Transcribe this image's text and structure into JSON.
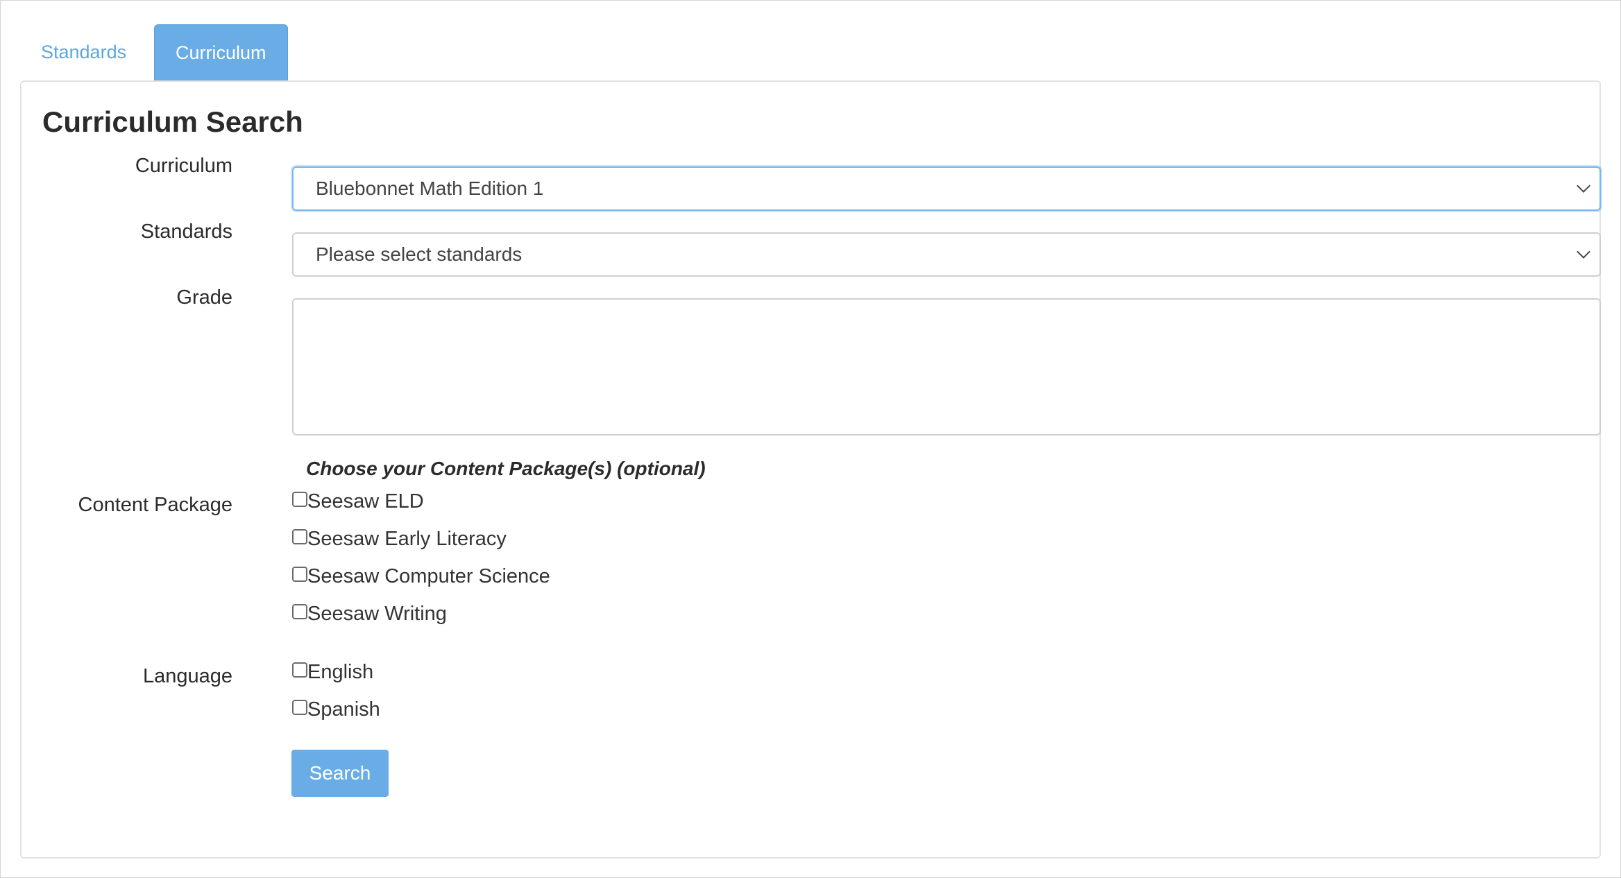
{
  "tabs": [
    {
      "label": "Standards",
      "active": false
    },
    {
      "label": "Curriculum",
      "active": true
    }
  ],
  "panel": {
    "title": "Curriculum Search"
  },
  "form": {
    "curriculum": {
      "label": "Curriculum",
      "value": "Bluebonnet Math Edition 1"
    },
    "standards": {
      "label": "Standards",
      "value": "Please select standards"
    },
    "grade": {
      "label": "Grade"
    },
    "content_package": {
      "label": "Content Package",
      "heading": "Choose your Content Package(s) (optional)",
      "options": [
        {
          "label": "Seesaw ELD",
          "checked": false
        },
        {
          "label": "Seesaw Early Literacy",
          "checked": false
        },
        {
          "label": "Seesaw Computer Science",
          "checked": false
        },
        {
          "label": "Seesaw Writing",
          "checked": false
        }
      ]
    },
    "language": {
      "label": "Language",
      "options": [
        {
          "label": "English",
          "checked": false
        },
        {
          "label": "Spanish",
          "checked": false
        }
      ]
    },
    "search_label": "Search"
  },
  "colors": {
    "accent": "#6aade6",
    "link": "#5aa8e0",
    "focus": "#7cb8f0"
  },
  "icons": {
    "dropdown": "chevron-down-icon"
  }
}
